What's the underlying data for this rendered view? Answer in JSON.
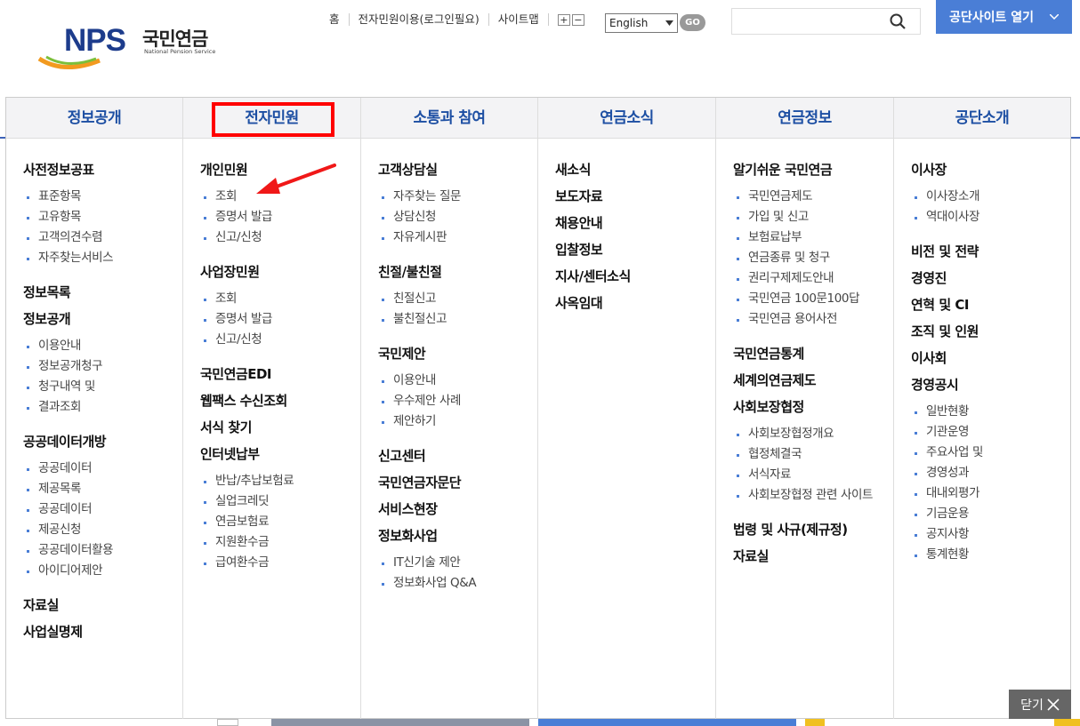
{
  "header": {
    "logo_text": "NPS",
    "logo_korean": "국민연금",
    "logo_english": "National Pension Service",
    "util_links": [
      "홈",
      "전자민원이용(로그인필요)",
      "사이트맵"
    ],
    "zoom_in": "+",
    "zoom_out": "−",
    "language": "English",
    "go_label": "GO",
    "search_placeholder": "",
    "open_sites_label": "공단사이트 열기"
  },
  "menu": {
    "columns": [
      {
        "title": "정보공개",
        "sections": [
          {
            "heading": "사전정보공표",
            "items": [
              "표준항목",
              "고유항목",
              "고객의견수렴",
              "자주찾는서비스"
            ]
          },
          {
            "heading": "정보목록",
            "items": []
          },
          {
            "heading": "정보공개",
            "items": [
              "이용안내",
              "정보공개청구",
              "청구내역 및",
              "결과조회"
            ]
          },
          {
            "heading": "공공데이터개방",
            "items": [
              "공공데이터",
              "제공목록",
              "공공데이터",
              "제공신청",
              "공공데이터활용",
              "아이디어제안"
            ]
          },
          {
            "heading": "자료실",
            "items": []
          },
          {
            "heading": "사업실명제",
            "items": []
          }
        ]
      },
      {
        "title": "전자민원",
        "sections": [
          {
            "heading": "개인민원",
            "items": [
              "조회",
              "증명서 발급",
              "신고/신청"
            ]
          },
          {
            "heading": "사업장민원",
            "items": [
              "조회",
              "증명서 발급",
              "신고/신청"
            ]
          },
          {
            "heading": "국민연금EDI",
            "items": []
          },
          {
            "heading": "웹팩스 수신조회",
            "items": []
          },
          {
            "heading": "서식 찾기",
            "items": []
          },
          {
            "heading": "인터넷납부",
            "items": [
              "반납/추납보험료",
              "실업크레딧",
              "연금보험료",
              "지원환수금",
              "급여환수금"
            ]
          }
        ]
      },
      {
        "title": "소통과 참여",
        "sections": [
          {
            "heading": "고객상담실",
            "items": [
              "자주찾는 질문",
              "상담신청",
              "자유게시판"
            ]
          },
          {
            "heading": "친절/불친절",
            "items": [
              "친절신고",
              "불친절신고"
            ]
          },
          {
            "heading": "국민제안",
            "items": [
              "이용안내",
              "우수제안 사례",
              "제안하기"
            ]
          },
          {
            "heading": "신고센터",
            "items": []
          },
          {
            "heading": "국민연금자문단",
            "items": []
          },
          {
            "heading": "서비스현장",
            "items": []
          },
          {
            "heading": "정보화사업",
            "items": [
              "IT신기술 제안",
              "정보화사업 Q&A"
            ]
          }
        ]
      },
      {
        "title": "연금소식",
        "sections": [
          {
            "heading": "새소식",
            "items": []
          },
          {
            "heading": "보도자료",
            "items": []
          },
          {
            "heading": "채용안내",
            "items": []
          },
          {
            "heading": "입찰정보",
            "items": []
          },
          {
            "heading": "지사/센터소식",
            "items": []
          },
          {
            "heading": "사옥임대",
            "items": []
          }
        ]
      },
      {
        "title": "연금정보",
        "sections": [
          {
            "heading": "알기쉬운 국민연금",
            "items": [
              "국민연금제도",
              "가입 및 신고",
              "보험료납부",
              "연금종류 및 청구",
              "권리구제제도안내",
              "국민연금 100문100답",
              "국민연금 용어사전"
            ]
          },
          {
            "heading": "국민연금통계",
            "items": []
          },
          {
            "heading": "세계의연금제도",
            "items": []
          },
          {
            "heading": "사회보장협정",
            "items": [
              "사회보장협정개요",
              "협정체결국",
              "서식자료",
              "사회보장협정 관련 사이트"
            ]
          },
          {
            "heading": "법령 및 사규(제규정)",
            "items": []
          },
          {
            "heading": "자료실",
            "items": []
          }
        ]
      },
      {
        "title": "공단소개",
        "sections": [
          {
            "heading": "이사장",
            "items": [
              "이사장소개",
              "역대이사장"
            ]
          },
          {
            "heading": "비전 및 전략",
            "items": []
          },
          {
            "heading": "경영진",
            "items": []
          },
          {
            "heading": "연혁 및 CI",
            "items": []
          },
          {
            "heading": "조직 및 인원",
            "items": []
          },
          {
            "heading": "이사회",
            "items": []
          },
          {
            "heading": "경영공시",
            "items": [
              "일반현황",
              "기관운영",
              "주요사업 및",
              "경영성과",
              "대내외평가",
              "기금운용",
              "공지사항",
              "통계현황"
            ]
          }
        ]
      }
    ]
  },
  "close_label": "닫기",
  "colors": {
    "accent": "#4a7ed6",
    "heading_blue": "#1d4fa3",
    "highlight": "#ff0000"
  }
}
